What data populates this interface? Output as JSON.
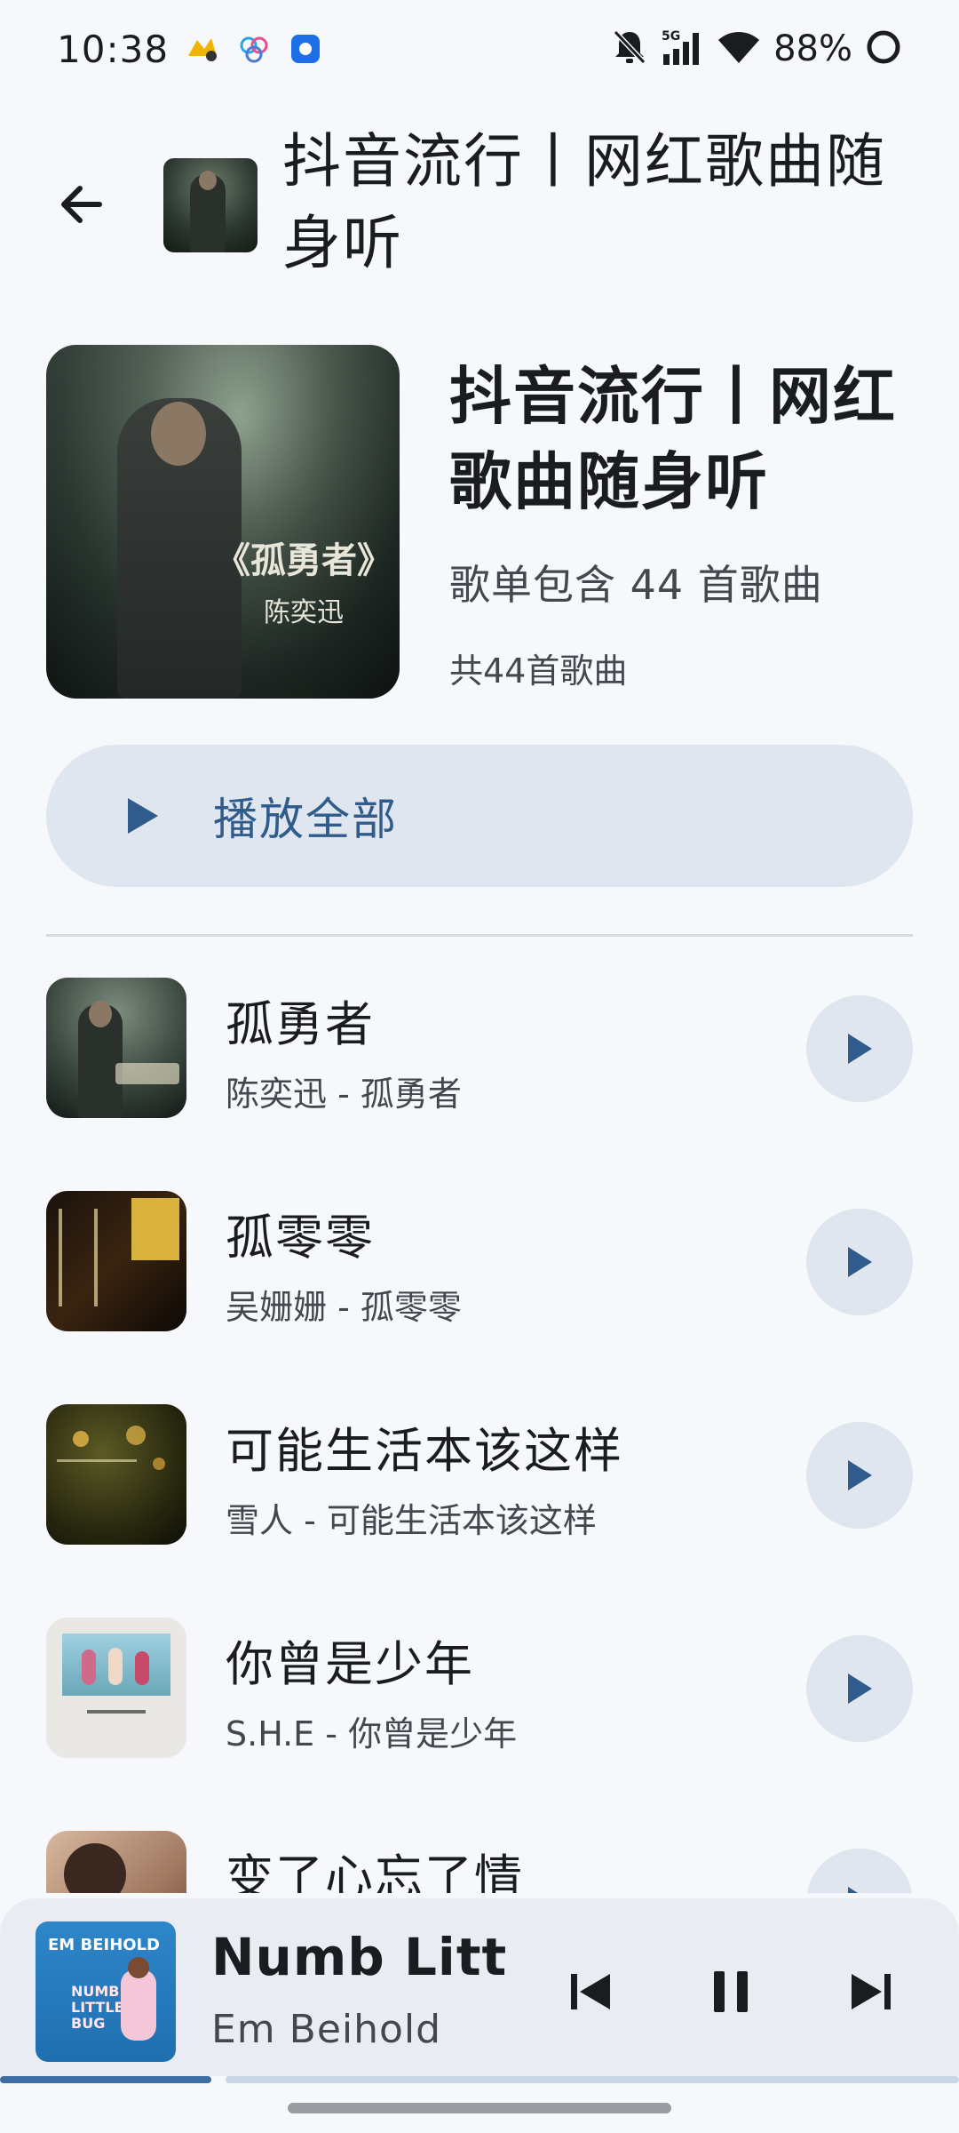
{
  "status_bar": {
    "time": "10:38",
    "battery": "88%",
    "network": "5G"
  },
  "app_bar": {
    "title": "抖音流行丨网红歌曲随身听"
  },
  "playlist": {
    "title": "抖音流行丨网红歌曲随身听",
    "description": "歌单包含 44 首歌曲",
    "count": "共44首歌曲",
    "cover_text_main": "《孤勇者》",
    "cover_text_artist": "陈奕迅"
  },
  "play_all": {
    "label": "播放全部"
  },
  "songs": [
    {
      "title": "孤勇者",
      "subtitle": "陈奕迅 - 孤勇者"
    },
    {
      "title": "孤零零",
      "subtitle": "吴姗姗 - 孤零零"
    },
    {
      "title": "可能生活本该这样",
      "subtitle": "雪人 - 可能生活本该这样"
    },
    {
      "title": "你曾是少年",
      "subtitle": "S.H.E - 你曾是少年"
    },
    {
      "title": "变了心忘了情",
      "subtitle": ""
    }
  ],
  "mini_player": {
    "title": "Numb Litt",
    "artist": "Em Beihold",
    "art_text": "EM BEIHOLD",
    "art_text2": "NUMB LITTLE BUG",
    "progress": 0.22
  },
  "colors": {
    "accent": "#3d6ea3",
    "surface": "#f6f8fc",
    "tonal_button": "#dfe6ef"
  },
  "icons": {
    "back": "arrow-left-icon",
    "play": "play-icon",
    "previous": "skip-previous-icon",
    "pause": "pause-icon",
    "next": "skip-next-icon"
  }
}
